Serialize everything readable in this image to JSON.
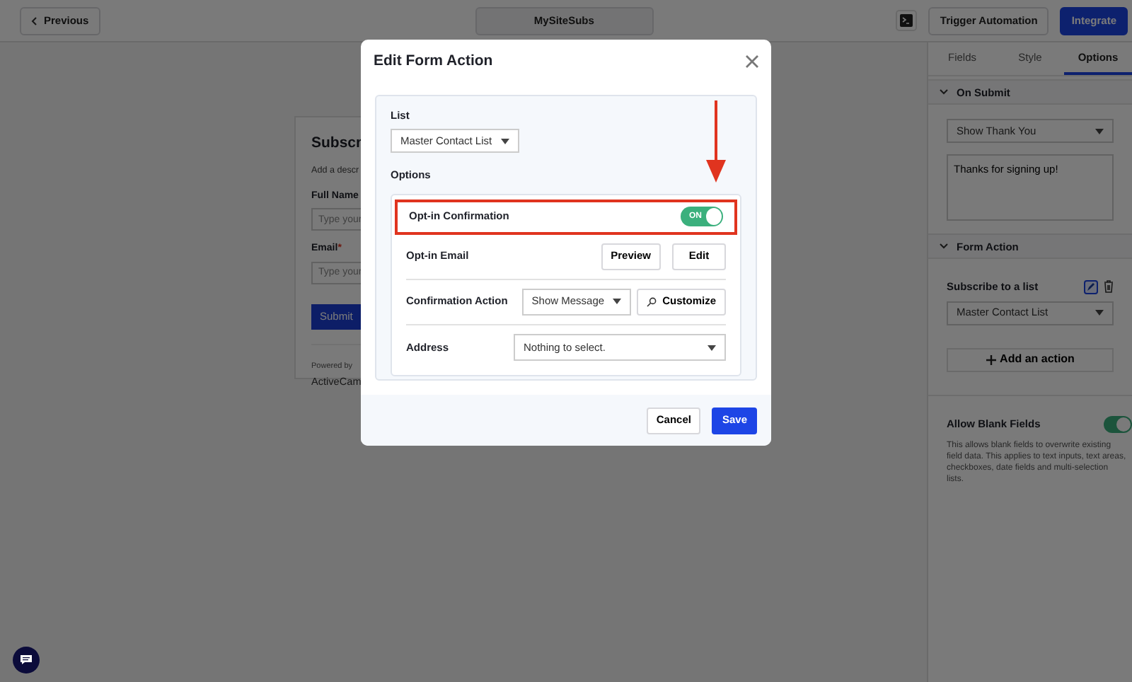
{
  "topbar": {
    "back_button": "Previous",
    "site_name": "MySiteSubs",
    "trigger_button": "Trigger Automation",
    "integrate_button": "Integrate"
  },
  "form_preview": {
    "title": "Subscr",
    "description": "Add a descr",
    "fields": [
      {
        "label": "Full Name",
        "placeholder": "Type your"
      },
      {
        "label": "Email",
        "required_mark": "*",
        "placeholder": "Type your"
      }
    ],
    "submit_button": "Submit",
    "powered_by": "Powered by",
    "brand": "ActiveCam"
  },
  "sidebar": {
    "tabs": [
      {
        "label": "Fields",
        "selected": false
      },
      {
        "label": "Style",
        "selected": false
      },
      {
        "label": "Options",
        "selected": true
      }
    ],
    "on_submit": {
      "title": "On Submit",
      "expanded": true,
      "select": "Show Thank You",
      "message": "Thanks for signing up!"
    },
    "form_action": {
      "title": "Form Action",
      "expanded": true,
      "action_label": "Subscribe to a list",
      "select": "Master Contact List",
      "add_button": "Add an action"
    },
    "allow_blank": {
      "label": "Allow Blank Fields",
      "on": true,
      "description": "This allows blank fields to overwrite existing field data. This applies to text inputs, text areas, checkboxes, date fields and multi-selection lists."
    }
  },
  "modal": {
    "title": "Edit Form Action",
    "list_label": "List",
    "list_select": "Master Contact List",
    "options_label": "Options",
    "rows": [
      {
        "kind": "toggle",
        "label": "Opt-in Confirmation",
        "on": true,
        "toggle_text": "ON",
        "highlighted": true
      },
      {
        "kind": "buttons",
        "label": "Opt-in Email",
        "buttons": [
          "Preview",
          "Edit"
        ]
      },
      {
        "kind": "select_button",
        "label": "Confirmation Action",
        "select": "Show Message",
        "button": "Customize"
      },
      {
        "kind": "select",
        "label": "Address",
        "select": "Nothing to select."
      }
    ],
    "cancel_button": "Cancel",
    "save_button": "Save"
  }
}
